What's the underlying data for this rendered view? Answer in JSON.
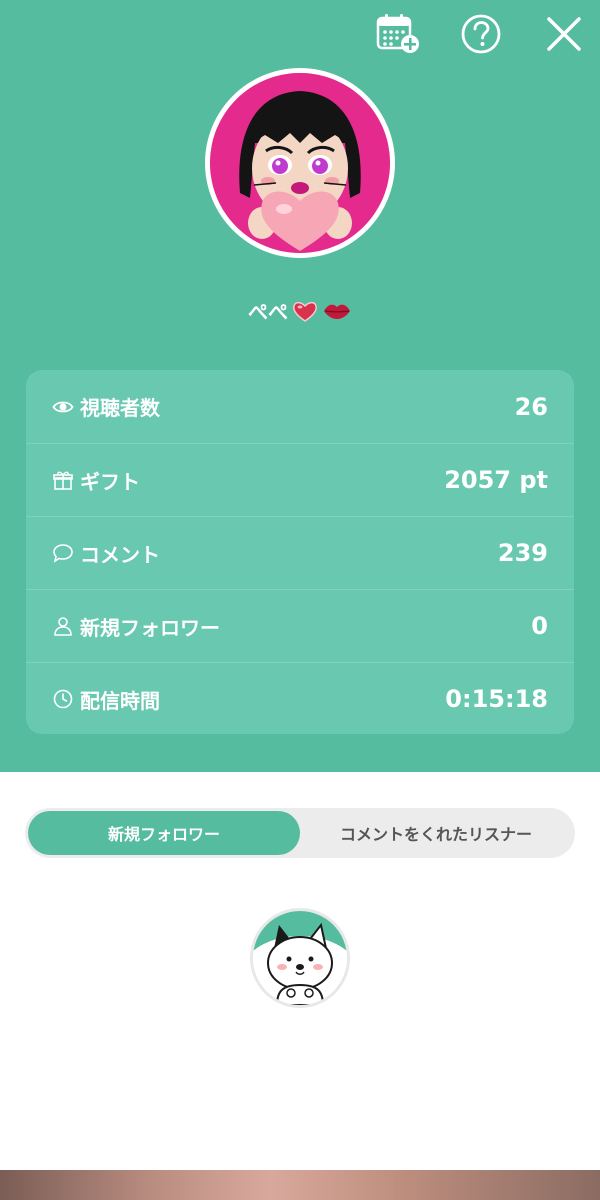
{
  "header": {
    "icons": [
      "calendar-add-icon",
      "help-icon",
      "close-icon"
    ]
  },
  "profile": {
    "username": "ぺぺ",
    "emojis": [
      "heart-emoji",
      "lips-emoji"
    ]
  },
  "stats": [
    {
      "icon": "eye-icon",
      "label": "視聴者数",
      "value": "26"
    },
    {
      "icon": "gift-icon",
      "label": "ギフト",
      "value": "2057 pt"
    },
    {
      "icon": "comment-icon",
      "label": "コメント",
      "value": "239"
    },
    {
      "icon": "person-icon",
      "label": "新規フォロワー",
      "value": "0"
    },
    {
      "icon": "clock-icon",
      "label": "配信時間",
      "value": "0:15:18"
    }
  ],
  "tabs": [
    {
      "label": "新規フォロワー",
      "active": true
    },
    {
      "label": "コメントをくれたリスナー",
      "active": false
    }
  ],
  "colors": {
    "primary": "#55bca0",
    "card": "#68c9b0",
    "avatar_bg": "#e52a8e",
    "tab_bg": "#ececec"
  }
}
